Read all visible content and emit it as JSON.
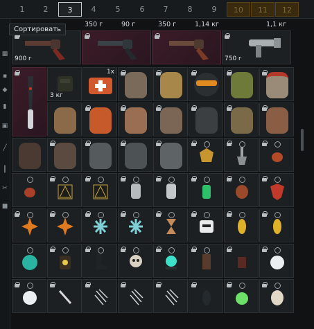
{
  "tabs": [
    {
      "label": "1",
      "state": "normal"
    },
    {
      "label": "2",
      "state": "normal"
    },
    {
      "label": "3",
      "state": "active"
    },
    {
      "label": "4",
      "state": "normal"
    },
    {
      "label": "5",
      "state": "normal"
    },
    {
      "label": "6",
      "state": "normal"
    },
    {
      "label": "7",
      "state": "normal"
    },
    {
      "label": "8",
      "state": "normal"
    },
    {
      "label": "9",
      "state": "normal"
    },
    {
      "label": "10",
      "state": "locked"
    },
    {
      "label": "11",
      "state": "locked"
    },
    {
      "label": "12",
      "state": "locked"
    }
  ],
  "tooltip": "Сортировать",
  "price_row": {
    "p1": "350 г",
    "p2": "90 г",
    "p3": "350 г",
    "p4": "1,14 кг",
    "p5": "1,1 кг"
  },
  "items": {
    "revolver1_weight": "900 г",
    "device_weight": "750 г",
    "pouch_weight": "3 кг",
    "medkit_count": "1x"
  },
  "colors": {
    "accent_active_tab": "#c9ccce",
    "locked_tab": "#3a2a0e",
    "highlight_cell": "#3b1c27"
  }
}
